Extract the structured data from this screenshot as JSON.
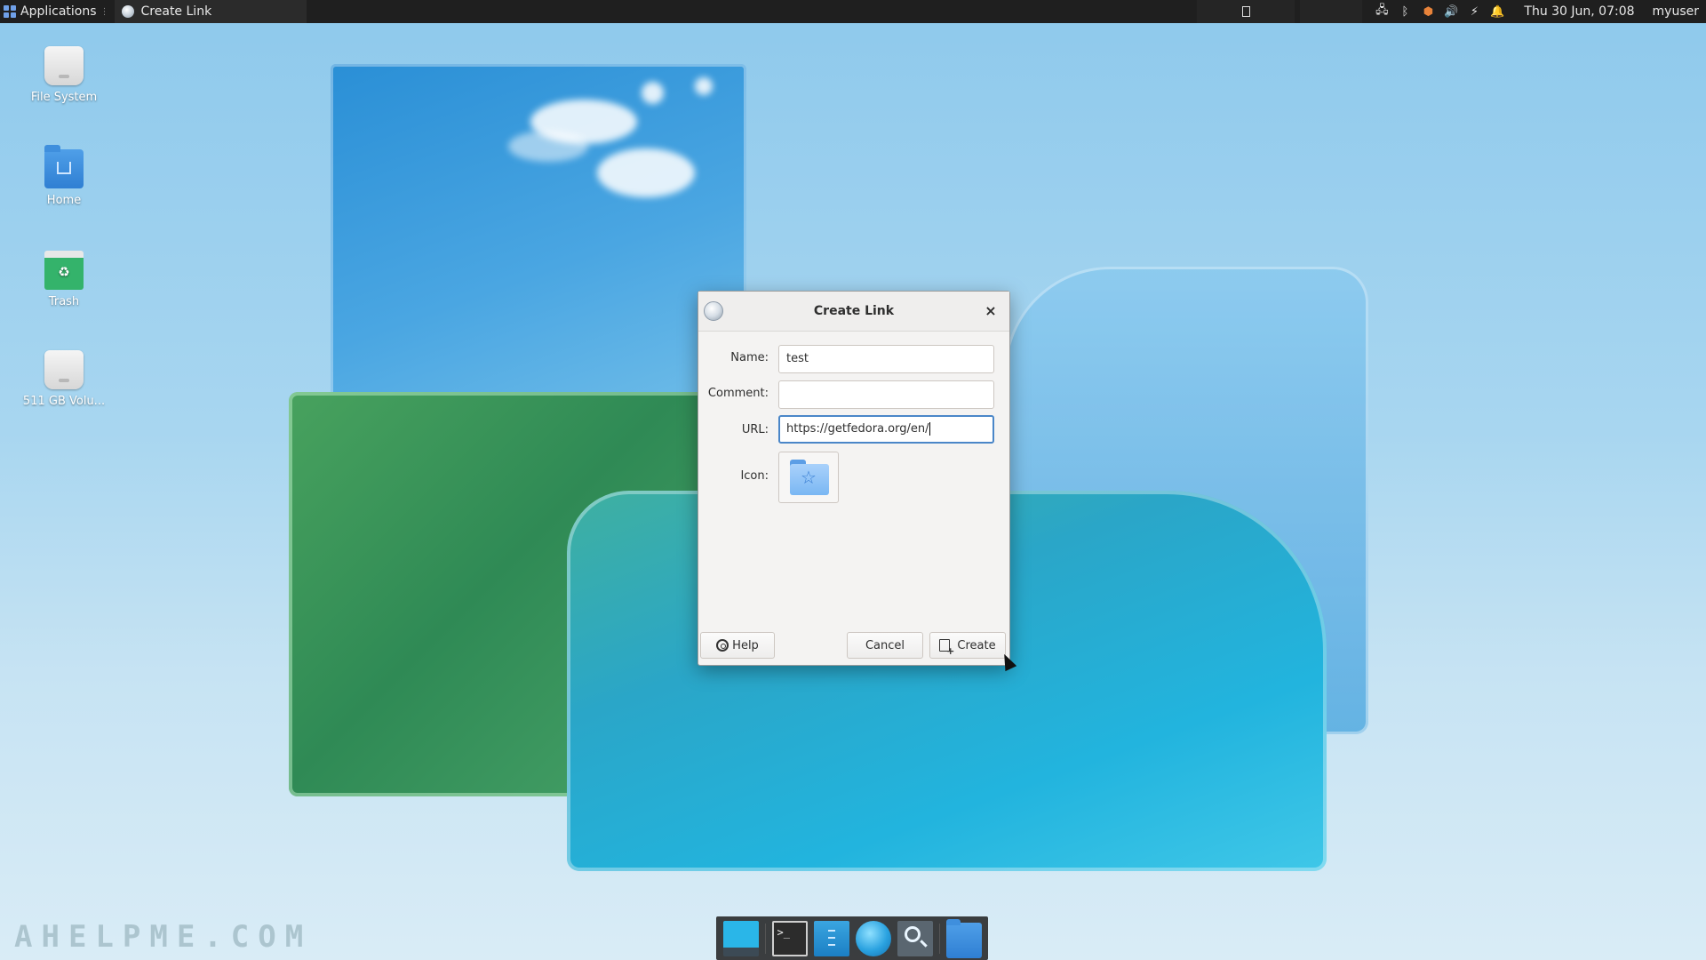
{
  "panel": {
    "applications_label": "Applications",
    "task_label": "Create Link",
    "clock": "Thu 30 Jun, 07:08",
    "user": "myuser"
  },
  "desktop": {
    "icons": [
      {
        "label": "File System",
        "icon": "drive-icon"
      },
      {
        "label": "Home",
        "icon": "home-folder-icon"
      },
      {
        "label": "Trash",
        "icon": "trash-icon"
      },
      {
        "label": "511 GB Volu...",
        "icon": "drive-icon"
      }
    ],
    "watermark": "AHELPME.COM"
  },
  "dialog": {
    "title": "Create Link",
    "close_glyph": "×",
    "fields": {
      "name_label": "Name:",
      "name_value": "test",
      "comment_label": "Comment:",
      "comment_value": "",
      "url_label": "URL:",
      "url_value": "https://getfedora.org/en/",
      "icon_label": "Icon:"
    },
    "buttons": {
      "help": "Help",
      "cancel": "Cancel",
      "create": "Create"
    }
  },
  "dock": {
    "items": [
      "show-desktop",
      "terminal",
      "file-manager",
      "web-browser",
      "app-finder",
      "files-folder"
    ],
    "terminal_prompt": ">_"
  },
  "colors": {
    "panel_bg": "#1f1f1f",
    "focus_border": "#4a86c8",
    "dialog_bg": "#f4f3f2"
  }
}
